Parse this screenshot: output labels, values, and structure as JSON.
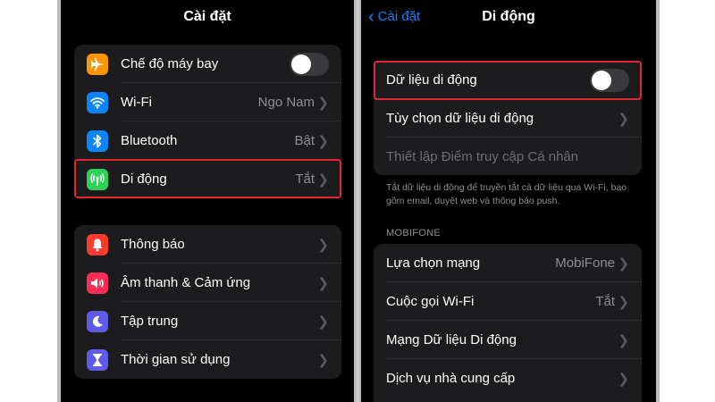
{
  "left": {
    "title": "Cài đặt",
    "group1": [
      {
        "label": "Chế độ máy bay",
        "icon": "airplane-icon",
        "color": "#ff9500",
        "control": "toggle",
        "toggle_on": false
      },
      {
        "label": "Wi-Fi",
        "value": "Ngo Nam",
        "icon": "wifi-icon",
        "color": "#0a84ff"
      },
      {
        "label": "Bluetooth",
        "value": "Bật",
        "icon": "bluetooth-icon",
        "color": "#0a84ff"
      },
      {
        "label": "Di động",
        "value": "Tắt",
        "icon": "antenna-icon",
        "color": "#30d158"
      }
    ],
    "group2": [
      {
        "label": "Thông báo",
        "icon": "bell-icon",
        "color": "#ff3b30"
      },
      {
        "label": "Âm thanh & Cảm ứng",
        "icon": "speaker-icon",
        "color": "#ff2d55"
      },
      {
        "label": "Tập trung",
        "icon": "moon-icon",
        "color": "#5e5ce6"
      },
      {
        "label": "Thời gian sử dụng",
        "icon": "hourglass-icon",
        "color": "#5e5ce6"
      }
    ]
  },
  "right": {
    "back_label": "Cài đặt",
    "title": "Di động",
    "group1": [
      {
        "label": "Dữ liệu di động",
        "control": "toggle",
        "toggle_on": false
      },
      {
        "label": "Tùy chọn dữ liệu di động"
      },
      {
        "label": "Thiết lập Điểm truy cập Cá nhân",
        "disabled": true
      }
    ],
    "footnote": "Tắt dữ liệu di động để truyền tắt cả dữ liệu qua Wi-Fi, bao gồm email, duyệt web và thông báo push.",
    "section_header": "MOBIFONE",
    "group2": [
      {
        "label": "Lựa chọn mạng",
        "value": "MobiFone"
      },
      {
        "label": "Cuộc gọi Wi-Fi",
        "value": "Tắt"
      },
      {
        "label": "Mạng Dữ liệu Di động"
      },
      {
        "label": "Dịch vụ nhà cung cấp"
      }
    ]
  },
  "colors": {
    "accent": "#0a84ff",
    "highlight": "#e1292c",
    "background": "#000000",
    "cell": "#1c1c1e"
  }
}
